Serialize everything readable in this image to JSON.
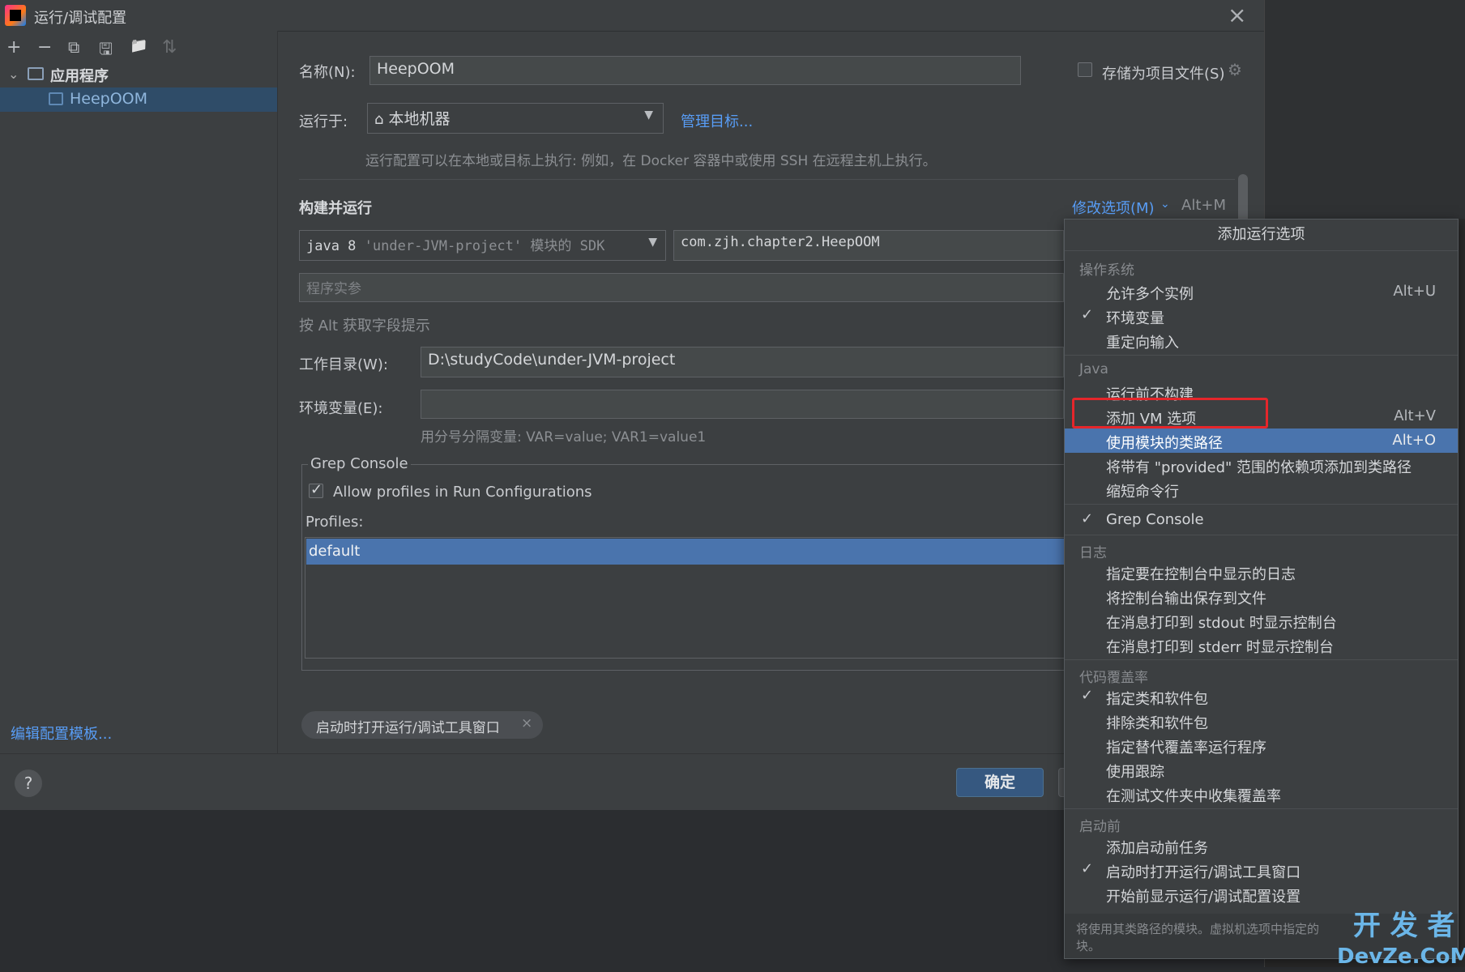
{
  "window": {
    "title": "运行/调试配置",
    "close_icon": "×"
  },
  "sidebar": {
    "toolbar": [
      "+",
      "−",
      "⧉",
      "🖫",
      "📁",
      "⇅"
    ],
    "root_label": "应用程序",
    "item_label": "HeepOOM",
    "edit_templates": "编辑配置模板..."
  },
  "form": {
    "name_label": "名称(N):",
    "name_value": "HeepOOM",
    "store_label": "存储为项目文件(S)",
    "run_on_label": "运行于:",
    "run_on_value": "本地机器",
    "manage_targets": "管理目标...",
    "run_on_hint": "运行配置可以在本地或目标上执行: 例如，在 Docker 容器中或使用 SSH 在远程主机上执行。",
    "build_run_title": "构建并运行",
    "modify_options": "修改选项(M)",
    "modify_shortcut": "Alt+M",
    "sdk_value_prefix": "java 8",
    "sdk_value_rest": "'under-JVM-project' 模块的 SDK",
    "main_class": "com.zjh.chapter2.HeepOOM",
    "program_args_placeholder": "程序实参",
    "alt_hint": "按 Alt 获取字段提示",
    "workdir_label": "工作目录(W):",
    "workdir_value": "D:\\studyCode\\under-JVM-project",
    "env_label": "环境变量(E):",
    "env_value": "",
    "env_hint": "用分号分隔变量: VAR=value; VAR1=value1",
    "grep_title": "Grep Console",
    "grep_allow": "Allow profiles in Run Configurations",
    "profiles_label": "Profiles:",
    "profiles": [
      "default"
    ],
    "chip_label": "启动时打开运行/调试工具窗口",
    "chip_close": "×"
  },
  "footer": {
    "help": "?",
    "ok": "确定"
  },
  "popup": {
    "title": "添加运行选项",
    "groups": [
      {
        "label": "操作系统",
        "items": [
          {
            "label": "允许多个实例",
            "shortcut": "Alt+U",
            "checked": false
          },
          {
            "label": "环境变量",
            "shortcut": "",
            "checked": true
          },
          {
            "label": "重定向输入",
            "shortcut": "",
            "checked": false
          }
        ]
      },
      {
        "label": "Java",
        "items": [
          {
            "label": "运行前不构建",
            "shortcut": "",
            "checked": false
          },
          {
            "label": "添加 VM 选项",
            "shortcut": "Alt+V",
            "checked": false
          },
          {
            "label": "使用模块的类路径",
            "shortcut": "Alt+O",
            "checked": false,
            "selected": true
          },
          {
            "label": "将带有 \"provided\" 范围的依赖项添加到类路径",
            "shortcut": "",
            "checked": false
          },
          {
            "label": "缩短命令行",
            "shortcut": "",
            "checked": false
          }
        ]
      },
      {
        "label": "",
        "items": [
          {
            "label": "Grep Console",
            "shortcut": "",
            "checked": true
          }
        ]
      },
      {
        "label": "日志",
        "items": [
          {
            "label": "指定要在控制台中显示的日志",
            "shortcut": "",
            "checked": false
          },
          {
            "label": "将控制台输出保存到文件",
            "shortcut": "",
            "checked": false
          },
          {
            "label": "在消息打印到 stdout 时显示控制台",
            "shortcut": "",
            "checked": false
          },
          {
            "label": "在消息打印到 stderr 时显示控制台",
            "shortcut": "",
            "checked": false
          }
        ]
      },
      {
        "label": "代码覆盖率",
        "items": [
          {
            "label": "指定类和软件包",
            "shortcut": "",
            "checked": true
          },
          {
            "label": "排除类和软件包",
            "shortcut": "",
            "checked": false
          },
          {
            "label": "指定替代覆盖率运行程序",
            "shortcut": "",
            "checked": false
          },
          {
            "label": "使用跟踪",
            "shortcut": "",
            "checked": false
          },
          {
            "label": "在测试文件夹中收集覆盖率",
            "shortcut": "",
            "checked": false
          }
        ]
      },
      {
        "label": "启动前",
        "items": [
          {
            "label": "添加启动前任务",
            "shortcut": "",
            "checked": false
          },
          {
            "label": "启动时打开运行/调试工具窗口",
            "shortcut": "",
            "checked": true
          },
          {
            "label": "开始前显示运行/调试配置设置",
            "shortcut": "",
            "checked": false
          }
        ]
      }
    ],
    "footer_text": "将使用其类路径的模块。虚拟机选项中指定的",
    "footer_text_2": "块。"
  },
  "watermark": {
    "line1": "开 发 者",
    "line2": "DevZe.CoM"
  }
}
